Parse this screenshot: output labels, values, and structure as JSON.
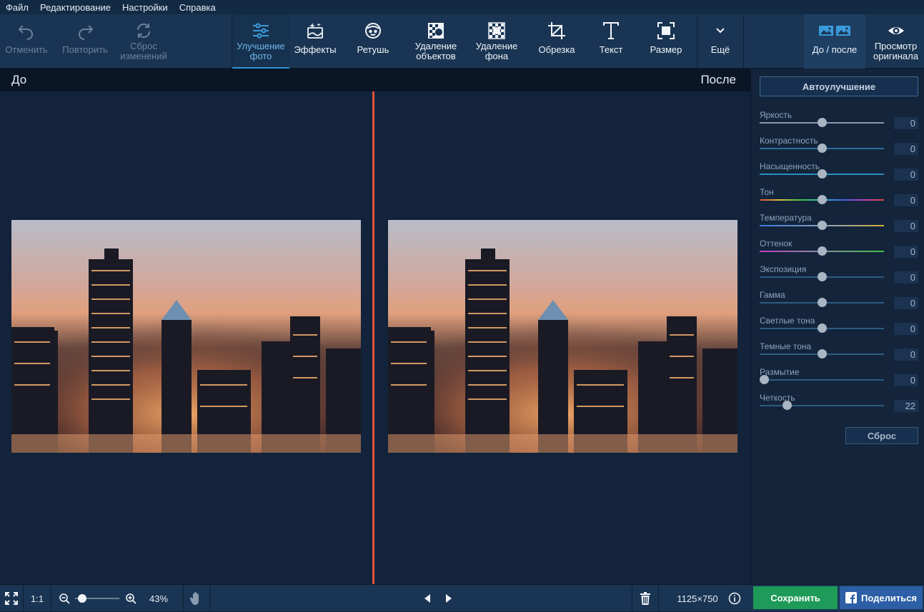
{
  "menu": [
    "Файл",
    "Редактирование",
    "Настройки",
    "Справка"
  ],
  "toolbar": {
    "undo": "Отменить",
    "redo": "Повторить",
    "reset_changes": [
      "Сброс",
      "изменений"
    ],
    "enhance": [
      "Улучшение",
      "фото"
    ],
    "effects": "Эффекты",
    "retouch": "Ретушь",
    "remove_objects": [
      "Удаление",
      "объектов"
    ],
    "remove_bg": [
      "Удаление",
      "фона"
    ],
    "crop": "Обрезка",
    "text": "Текст",
    "resize": "Размер",
    "more": "Ещё",
    "before_after": "До / после",
    "view_original": [
      "Просмотр",
      "оригинала"
    ]
  },
  "compare": {
    "before": "До",
    "after": "После"
  },
  "panel": {
    "auto": "Автоулучшение",
    "reset": "Сброс",
    "sliders": [
      {
        "label": "Яркость",
        "value": "0",
        "pos": 0.5,
        "track": "#8a99aa"
      },
      {
        "label": "Контрастность",
        "value": "0",
        "pos": 0.5,
        "track": "#2f6d9a"
      },
      {
        "label": "Насыщенность",
        "value": "0",
        "pos": 0.5,
        "track": "#2a8fc0"
      },
      {
        "label": "Тон",
        "value": "0",
        "pos": 0.5,
        "track": "gradient-hue"
      },
      {
        "label": "Температура",
        "value": "0",
        "pos": 0.5,
        "track": "gradient-temp"
      },
      {
        "label": "Оттенок",
        "value": "0",
        "pos": 0.5,
        "track": "gradient-tint"
      },
      {
        "label": "Экспозиция",
        "value": "0",
        "pos": 0.5,
        "track": "#2f5b80"
      },
      {
        "label": "Гамма",
        "value": "0",
        "pos": 0.5,
        "track": "#2f5b80"
      },
      {
        "label": "Светлые тона",
        "value": "0",
        "pos": 0.5,
        "track": "#2f5b80"
      },
      {
        "label": "Темные тона",
        "value": "0",
        "pos": 0.5,
        "track": "#2f5b80"
      },
      {
        "label": "Размытие",
        "value": "0",
        "pos": 0.0,
        "track": "#2f5b80"
      },
      {
        "label": "Четкость",
        "value": "22",
        "pos": 0.22,
        "track": "#2f5b80"
      }
    ]
  },
  "bottom": {
    "ratio": "1:1",
    "zoom": "43%",
    "size": "1125×750",
    "save": "Сохранить",
    "share": "Поделиться"
  }
}
